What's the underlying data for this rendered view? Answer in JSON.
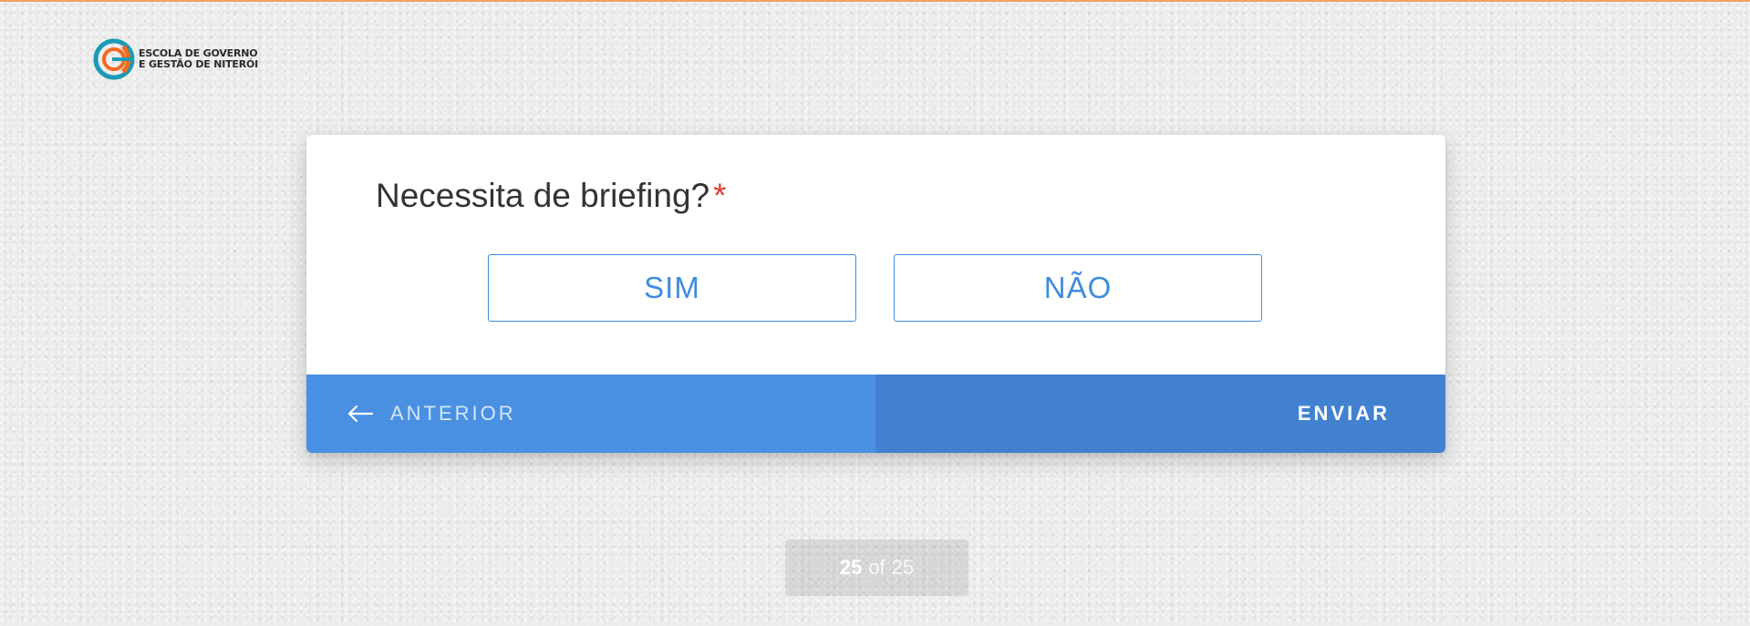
{
  "brand": {
    "line1": "ESCOLA DE GOVERNO",
    "line2": "E GESTÃO DE NITERÓI",
    "colors": {
      "teal": "#1a9bb5",
      "orange": "#f26a21"
    }
  },
  "question": {
    "text": "Necessita de briefing?",
    "required_mark": "*",
    "options": [
      "SIM",
      "NÃO"
    ]
  },
  "navigation": {
    "prev_label": "ANTERIOR",
    "submit_label": "ENVIAR"
  },
  "pager": {
    "current": "25",
    "separator": "of",
    "total": "25"
  },
  "colors": {
    "accent": "#3f8be0",
    "footer_left": "#4a90e2",
    "footer_right": "#4281cf",
    "required": "#e53935"
  }
}
